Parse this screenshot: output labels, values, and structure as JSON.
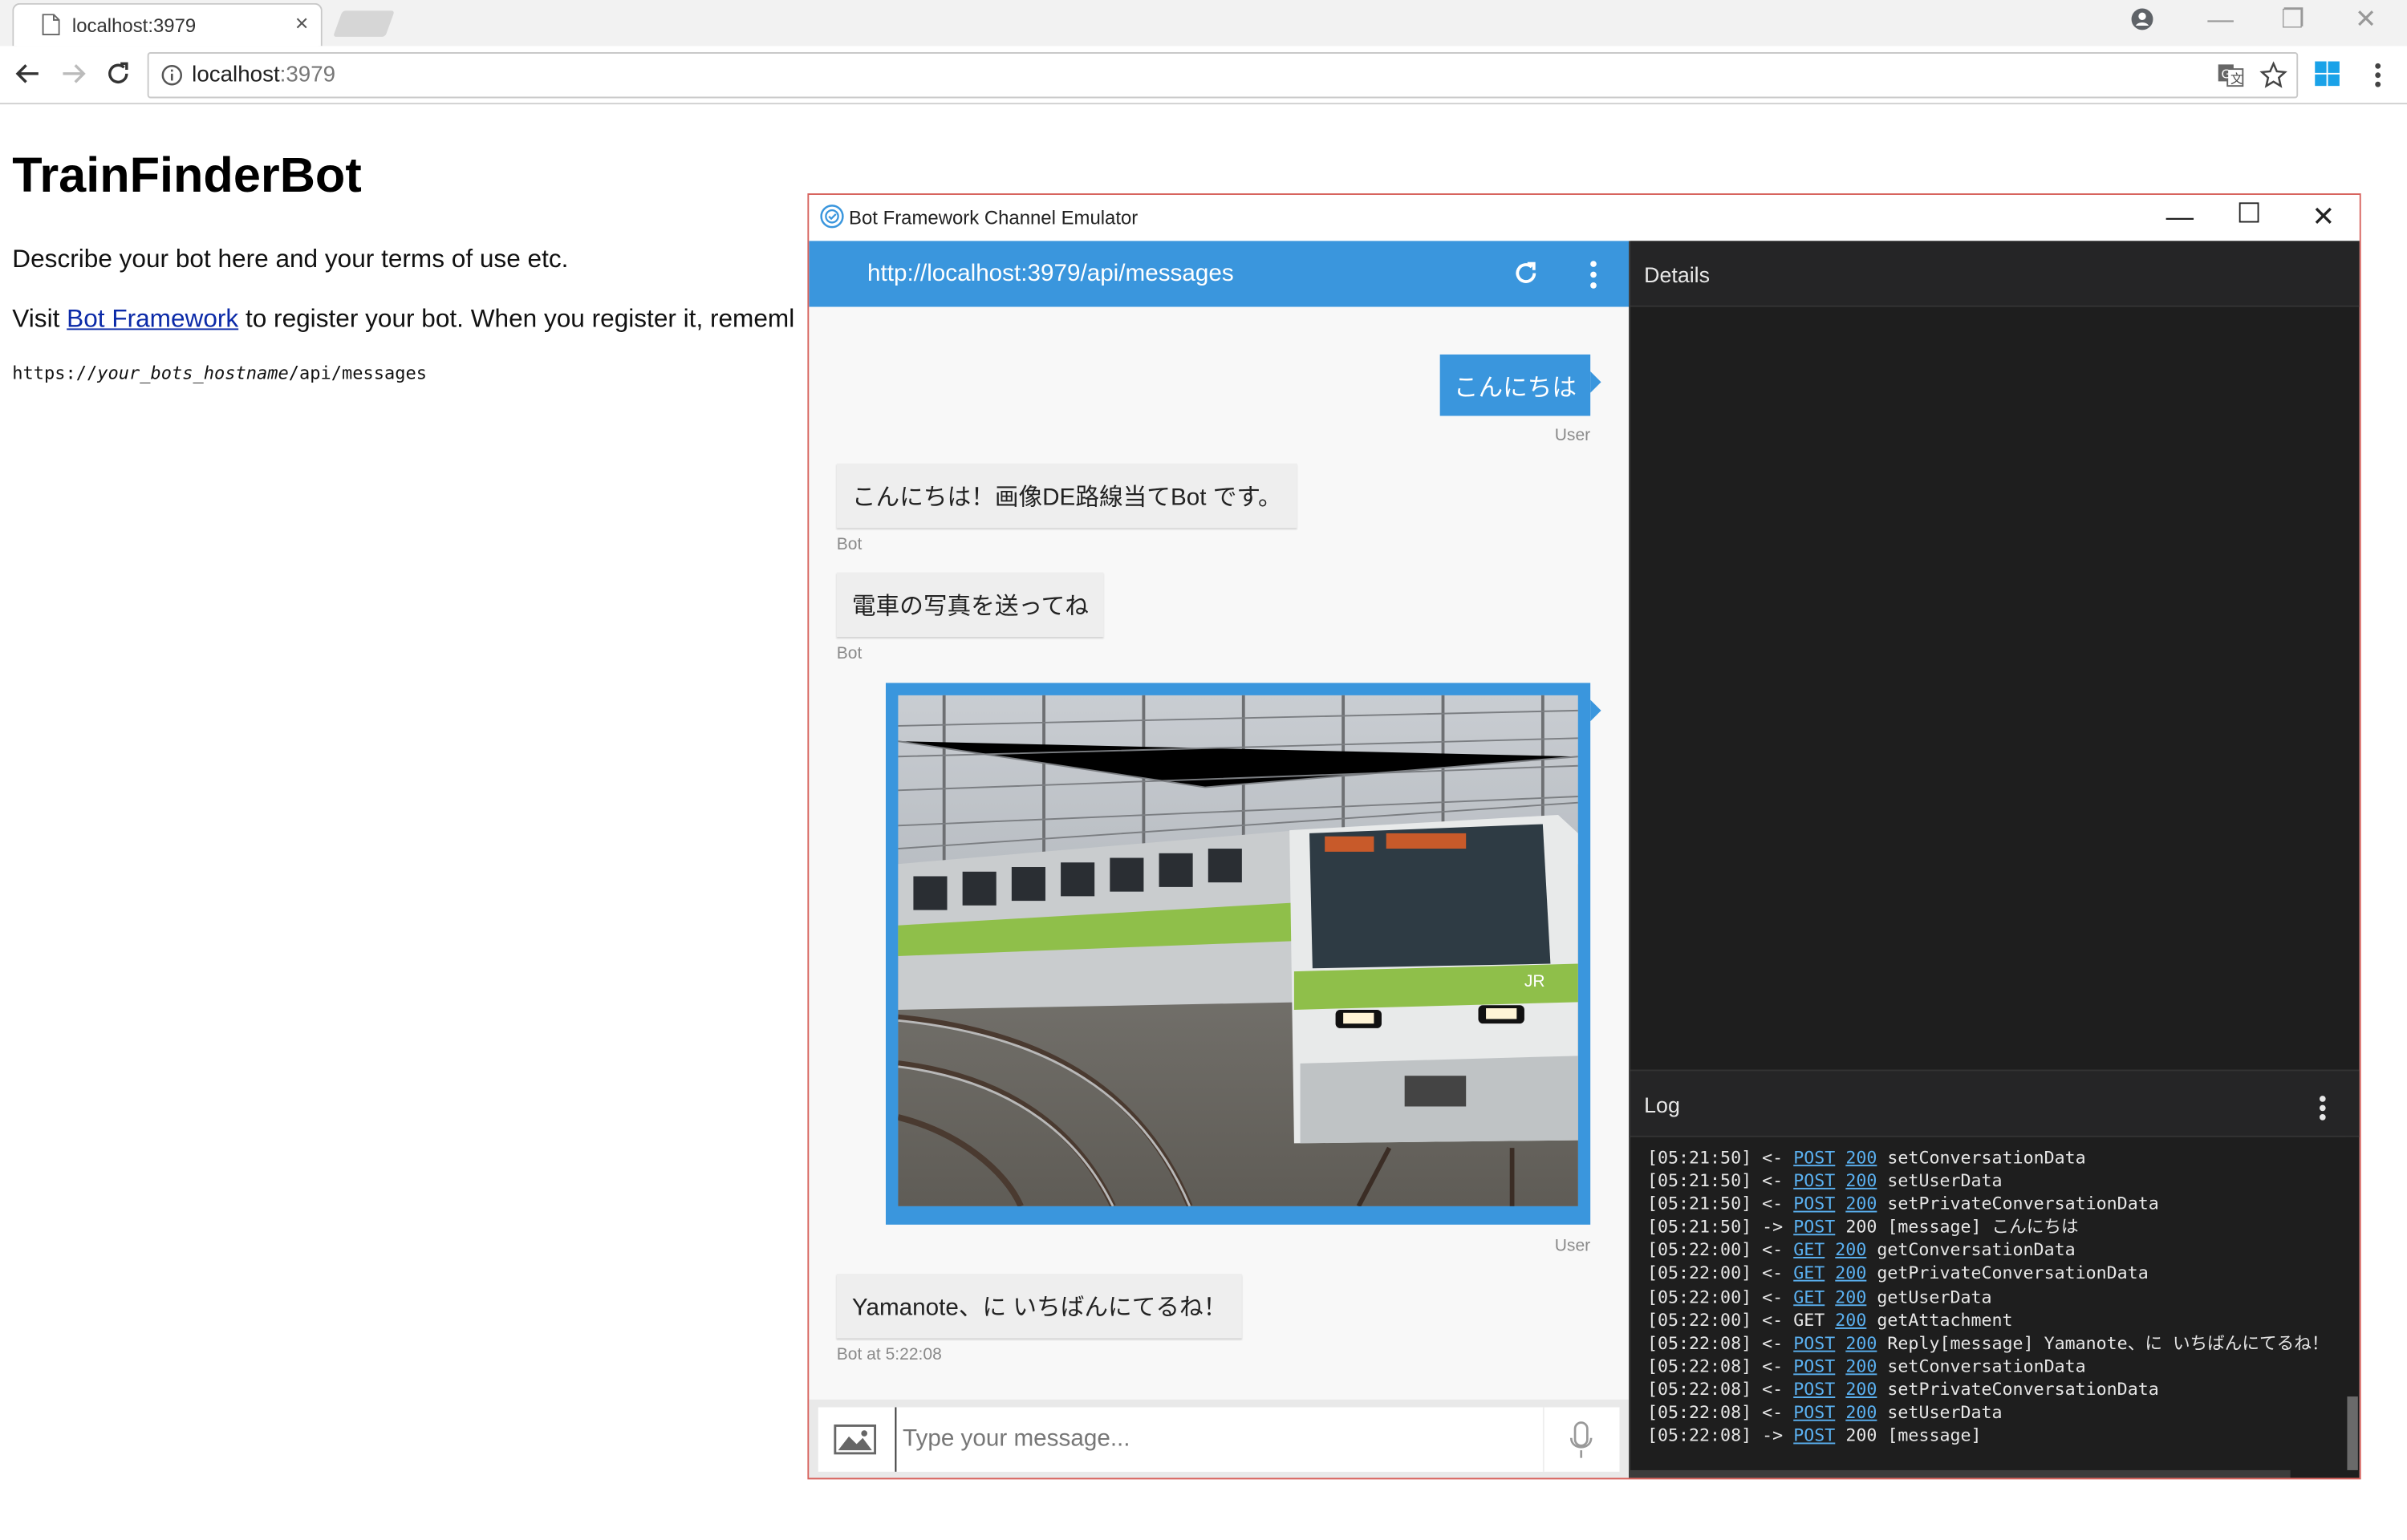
{
  "browser": {
    "tab_title": "localhost:3979",
    "tab_close": "×",
    "url_host": "localhost",
    "url_port": ":3979"
  },
  "page": {
    "heading": "TrainFinderBot",
    "description": "Describe your bot here and your terms of use etc.",
    "visit_prefix": "Visit ",
    "visit_link": "Bot Framework",
    "visit_suffix": " to register your bot. When you register it, rememl",
    "endpoint_prefix": "https://",
    "endpoint_host": "your_bots_hostname",
    "endpoint_suffix": "/api/messages"
  },
  "emulator": {
    "window_title": "Bot Framework Channel Emulator",
    "endpoint_url": "http://localhost:3979/api/messages",
    "details_title": "Details",
    "log_title": "Log",
    "input_placeholder": "Type your message..."
  },
  "messages": [
    {
      "from": "user",
      "text": "こんにちは",
      "sender": "User"
    },
    {
      "from": "bot",
      "text": "こんにちは！画像DE路線当てBot です。",
      "sender": "Bot"
    },
    {
      "from": "bot",
      "text": "電車の写真を送ってね",
      "sender": "Bot"
    },
    {
      "from": "user",
      "image": "train-photo",
      "sender": "User"
    },
    {
      "from": "bot",
      "text": "Yamanote、に いちばんにてるね！",
      "sender": "Bot at 5:22:08"
    }
  ],
  "log": [
    {
      "time": "[05:21:50]",
      "dir": "<-",
      "method": "POST",
      "method_link": true,
      "code": "200",
      "code_link": true,
      "text": "setConversationData"
    },
    {
      "time": "[05:21:50]",
      "dir": "<-",
      "method": "POST",
      "method_link": true,
      "code": "200",
      "code_link": true,
      "text": "setUserData"
    },
    {
      "time": "[05:21:50]",
      "dir": "<-",
      "method": "POST",
      "method_link": true,
      "code": "200",
      "code_link": true,
      "text": "setPrivateConversationData"
    },
    {
      "time": "[05:21:50]",
      "dir": "->",
      "method": "POST",
      "method_link": true,
      "code": "200",
      "code_link": false,
      "text": "[message] こんにちは"
    },
    {
      "time": "[05:22:00]",
      "dir": "<-",
      "method": "GET",
      "method_link": true,
      "code": "200",
      "code_link": true,
      "text": "getConversationData"
    },
    {
      "time": "[05:22:00]",
      "dir": "<-",
      "method": "GET",
      "method_link": true,
      "code": "200",
      "code_link": true,
      "text": "getPrivateConversationData"
    },
    {
      "time": "[05:22:00]",
      "dir": "<-",
      "method": "GET",
      "method_link": true,
      "code": "200",
      "code_link": true,
      "text": "getUserData"
    },
    {
      "time": "[05:22:00]",
      "dir": "<-",
      "method": "GET",
      "method_link": false,
      "code": "200",
      "code_link": true,
      "text": "getAttachment"
    },
    {
      "time": "[05:22:08]",
      "dir": "<-",
      "method": "POST",
      "method_link": true,
      "code": "200",
      "code_link": true,
      "text": "Reply[message] Yamanote、に いちばんにてるね！"
    },
    {
      "time": "[05:22:08]",
      "dir": "<-",
      "method": "POST",
      "method_link": true,
      "code": "200",
      "code_link": true,
      "text": "setConversationData"
    },
    {
      "time": "[05:22:08]",
      "dir": "<-",
      "method": "POST",
      "method_link": true,
      "code": "200",
      "code_link": true,
      "text": "setPrivateConversationData"
    },
    {
      "time": "[05:22:08]",
      "dir": "<-",
      "method": "POST",
      "method_link": true,
      "code": "200",
      "code_link": true,
      "text": "setUserData"
    },
    {
      "time": "[05:22:08]",
      "dir": "->",
      "method": "POST",
      "method_link": true,
      "code": "200",
      "code_link": false,
      "text": "[message]"
    }
  ],
  "colors": {
    "accent": "#3a96dd",
    "dark_panel": "#1e1e1e",
    "link": "#5ab0f0"
  }
}
